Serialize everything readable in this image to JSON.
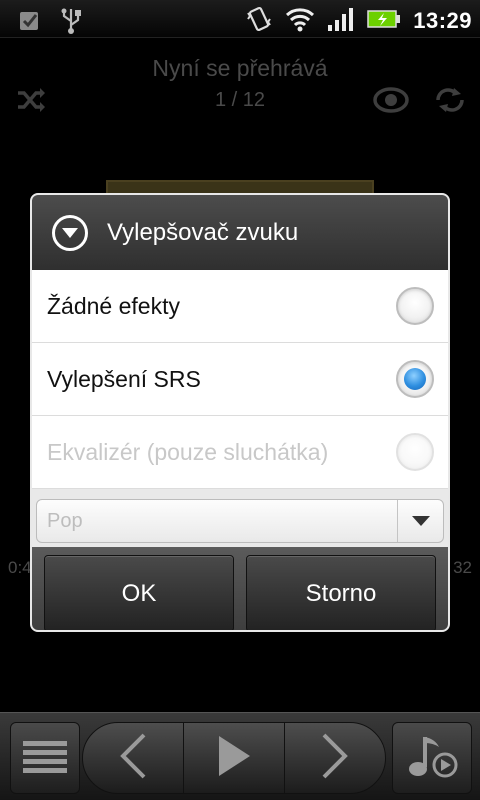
{
  "status_bar": {
    "time": "13:29",
    "icons": [
      "checkbox-notification-icon",
      "usb-icon",
      "vibrate-icon",
      "wifi-icon",
      "signal-icon",
      "battery-charging-icon"
    ]
  },
  "now_playing": {
    "title": "Nyní se přehrává",
    "track_counter": "1 / 12",
    "time_elapsed": "0:4",
    "time_total": "32"
  },
  "dialog": {
    "title": "Vylepšovač zvuku",
    "options": [
      {
        "label": "Žádné efekty",
        "selected": false,
        "enabled": true
      },
      {
        "label": "Vylepšení SRS",
        "selected": true,
        "enabled": true
      },
      {
        "label": "Ekvalizér (pouze sluchátka)",
        "selected": false,
        "enabled": false
      }
    ],
    "preset_select": {
      "value": "Pop",
      "enabled": false
    },
    "ok_label": "OK",
    "cancel_label": "Storno"
  },
  "colors": {
    "radio_selected": "#2f8fe0",
    "dialog_header": "#3c3c3c",
    "battery": "#6cd000"
  }
}
